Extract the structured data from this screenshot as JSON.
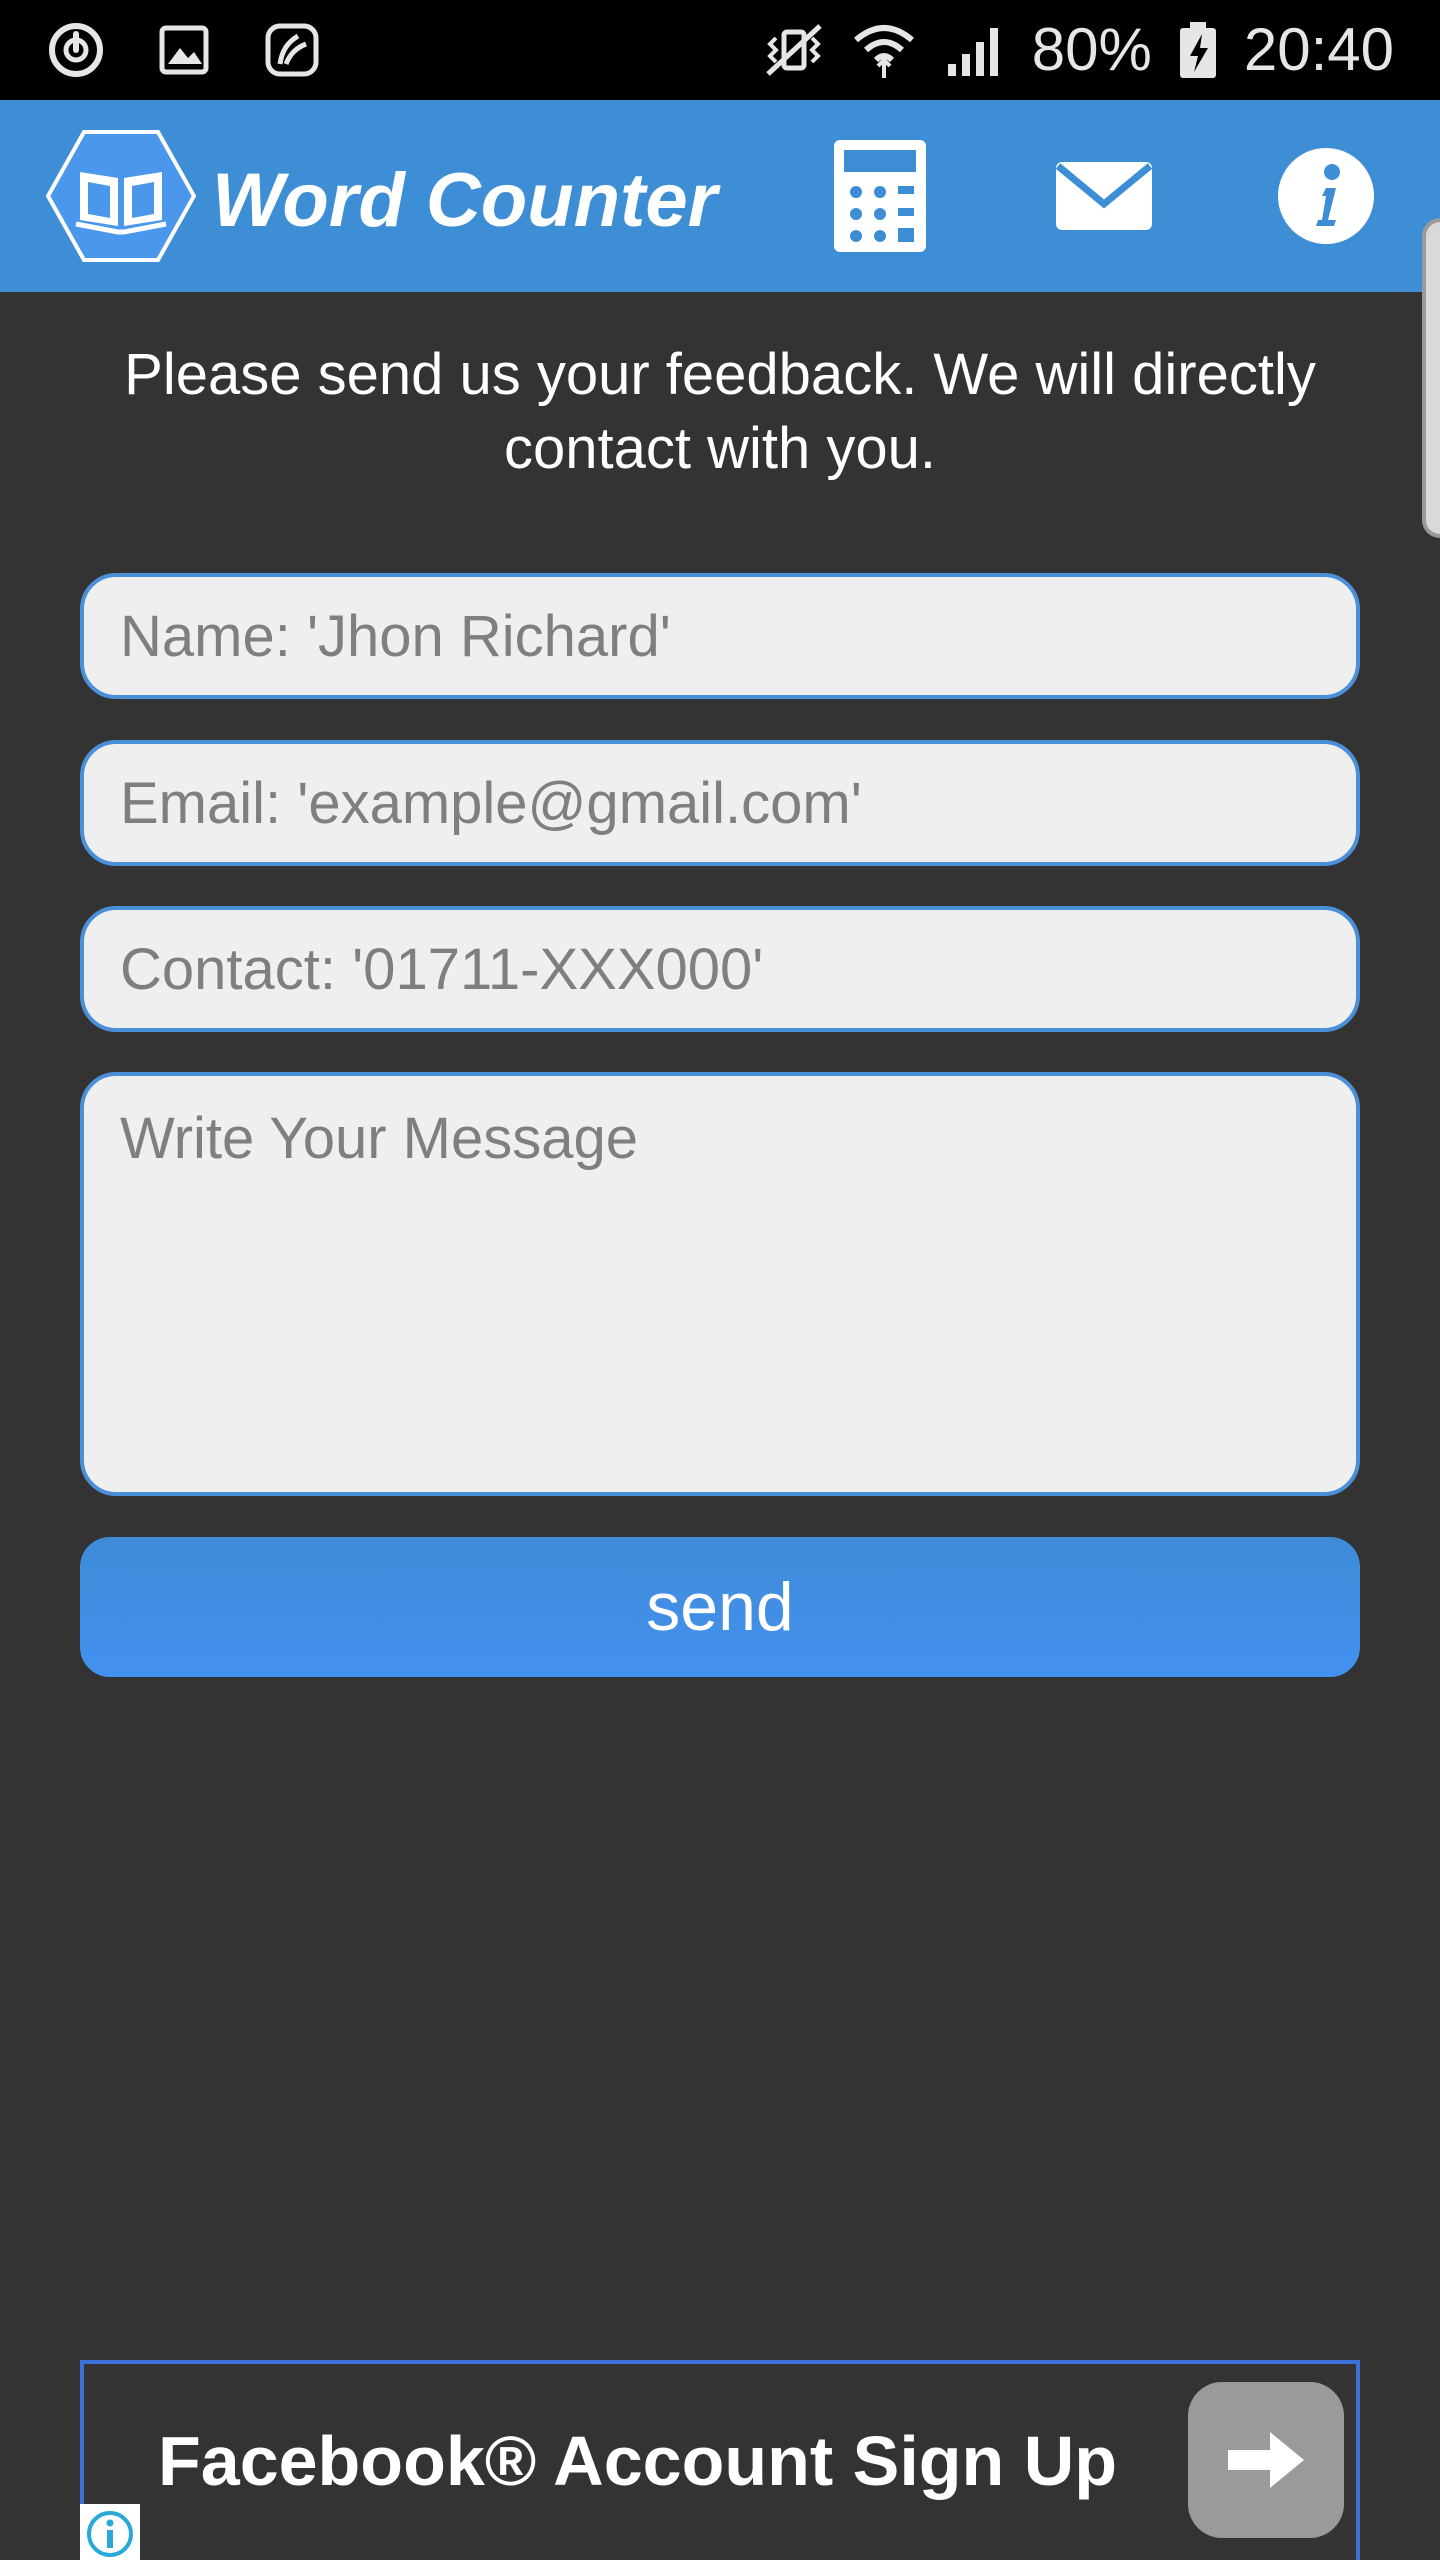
{
  "status_bar": {
    "battery_percent": "80%",
    "time": "20:40",
    "icons_left": [
      "power-sync-icon",
      "gallery-icon",
      "app-notification-icon"
    ],
    "icons_right": [
      "vibrate-icon",
      "wifi-icon",
      "signal-icon",
      "battery-charging-icon"
    ]
  },
  "app_bar": {
    "title": "Word Counter",
    "logo_icon": "book-hex-icon",
    "actions": [
      "calculator-icon",
      "mail-icon",
      "info-icon"
    ],
    "color": "#3e8ed6"
  },
  "feedback": {
    "intro": "Please send us your feedback. We will directly contact with you.",
    "name_placeholder": "Name: 'Jhon Richard'",
    "email_placeholder": "Email: 'example@gmail.com'",
    "contact_placeholder": "Contact: '01711-XXX000'",
    "message_placeholder": "Write Your Message",
    "send_label": "send"
  },
  "ad": {
    "text": "Facebook® Account Sign Up",
    "arrow_icon": "arrow-right-icon",
    "info_icon": "ad-info-icon"
  },
  "colors": {
    "background": "#333333",
    "accent": "#4391f0",
    "field_border": "#4a90d9"
  }
}
